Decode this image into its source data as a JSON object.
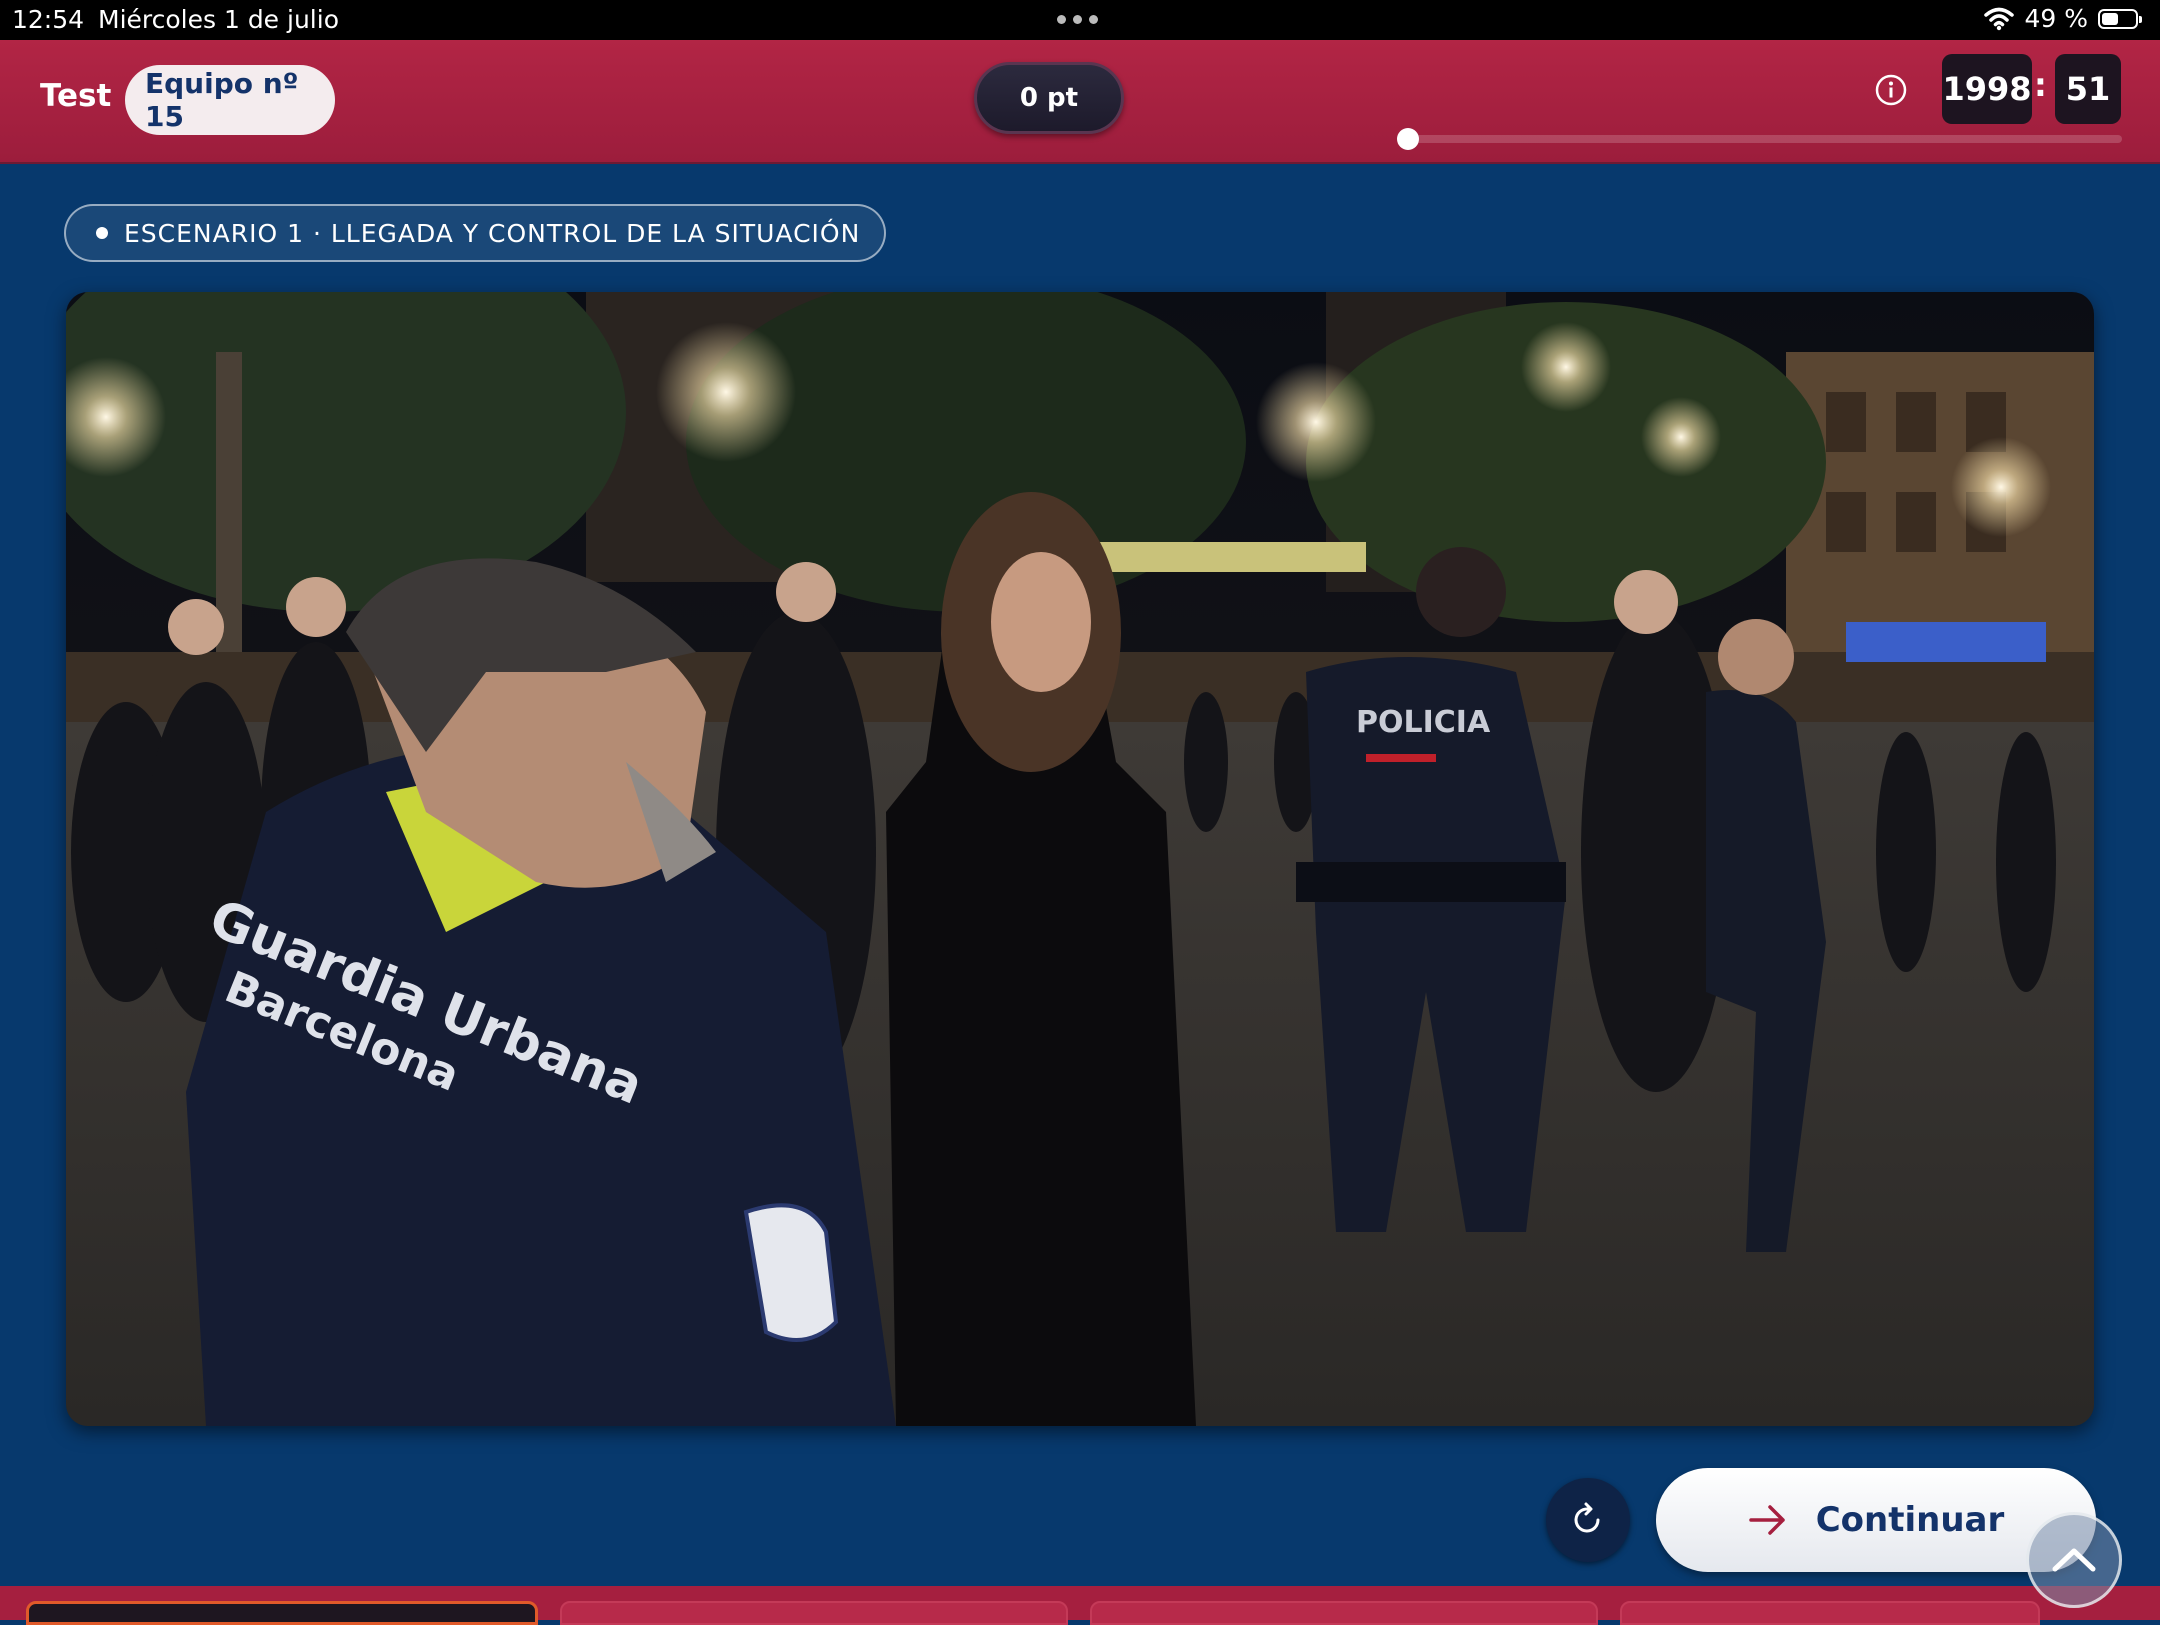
{
  "status_bar": {
    "time": "12:54",
    "date": "Miércoles 1 de julio",
    "battery": "49 %",
    "battery_level": 0.49
  },
  "header": {
    "title": "Test",
    "team": "Equipo nº 15",
    "points": "0 pt",
    "timer_minutes": "1998",
    "timer_separator": ":",
    "timer_seconds": "51",
    "progress": 0.0
  },
  "scenario": {
    "label": "ESCENARIO 1 · LLEGADA Y CONTROL DE LA SITUACIÓN"
  },
  "photo": {
    "uniform_text_left": "Guardia Urbana",
    "uniform_text_left_sub": "Barcelona",
    "uniform_text_center": "POLICIA"
  },
  "actions": {
    "continue_label": "Continuar"
  },
  "colors": {
    "header": "#a51f3f",
    "background": "#07396d",
    "accent_text": "#14336a",
    "arrow": "#a51f3f"
  },
  "icons": {
    "info": "info-icon",
    "wifi": "wifi-icon",
    "battery": "battery-icon",
    "reset": "refresh-icon",
    "continue": "arrow-right-icon",
    "scroll": "chevron-up-icon"
  }
}
